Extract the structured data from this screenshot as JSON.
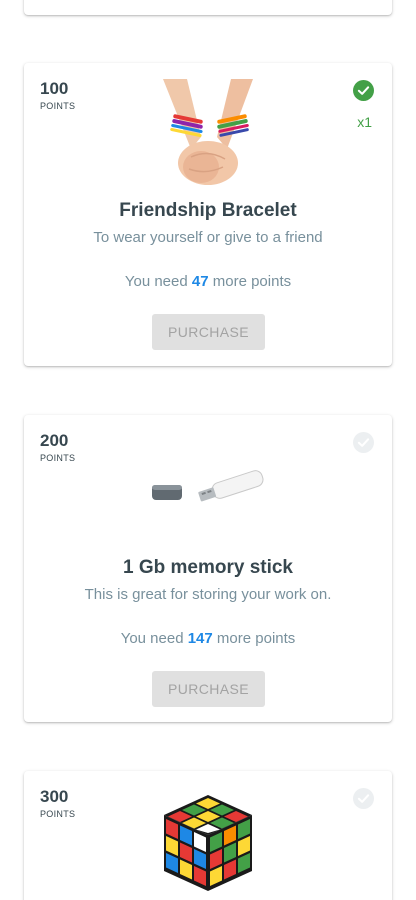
{
  "rewards": [
    {
      "points": "100",
      "points_label": "POINTS",
      "owned": true,
      "owned_count": "x1",
      "image": "friendship-bracelet-hands-photo",
      "title": "Friendship Bracelet",
      "description": "To wear yourself or give to a friend",
      "need_prefix": "You need",
      "need_value": "47",
      "need_suffix": "more points",
      "button_label": "PURCHASE"
    },
    {
      "points": "200",
      "points_label": "POINTS",
      "owned": false,
      "image": "usb-memory-stick-photo",
      "title": "1 Gb memory stick",
      "description": "This is great for storing your work on.",
      "need_prefix": "You need",
      "need_value": "147",
      "need_suffix": "more points",
      "button_label": "PURCHASE"
    },
    {
      "points": "300",
      "points_label": "POINTS",
      "owned": false,
      "image": "rubiks-cube-photo"
    }
  ],
  "colors": {
    "owned_check": "#43a047",
    "unowned_check": "#eceff1",
    "need_value": "#1e88e5",
    "button_disabled": "#e0e0e0"
  }
}
